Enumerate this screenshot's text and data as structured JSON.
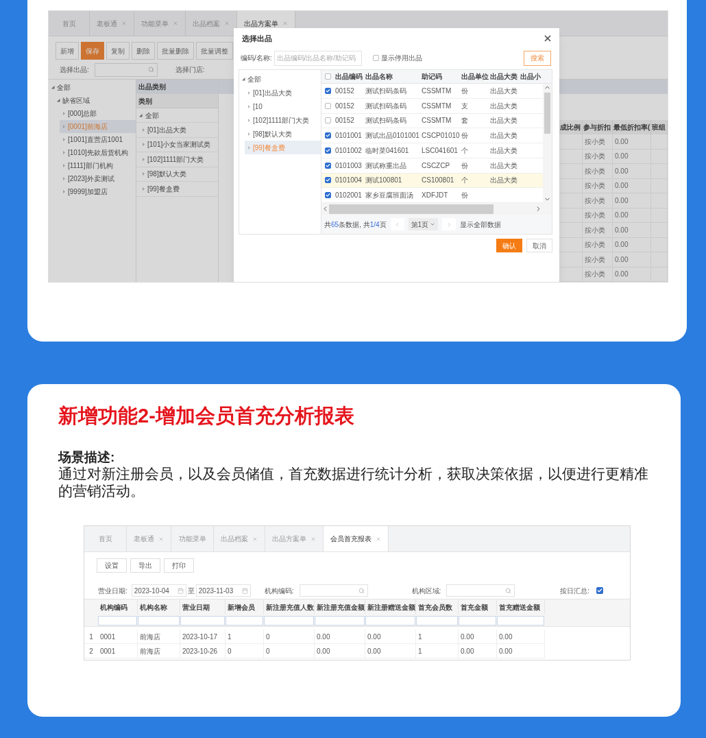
{
  "top_screenshot": {
    "tabs": [
      {
        "label": "首页",
        "closable": false,
        "selected": false
      },
      {
        "label": "老板通",
        "closable": true,
        "selected": false
      },
      {
        "label": "功能菜单",
        "closable": true,
        "selected": false
      },
      {
        "label": "出品档案",
        "closable": true,
        "selected": false
      },
      {
        "label": "出品方案单",
        "closable": true,
        "selected": true
      }
    ],
    "toolbar": [
      {
        "label": "新增",
        "primary": false
      },
      {
        "label": "保存",
        "primary": true
      },
      {
        "label": "复制",
        "primary": false
      },
      {
        "label": "删除",
        "primary": false
      },
      {
        "label": "批量删除",
        "primary": false
      },
      {
        "label": "批量调整",
        "primary": false
      }
    ],
    "product_label": "选择出品:",
    "store_label": "选择门店:",
    "org_tree": [
      {
        "label": "全部",
        "selected": false,
        "children": [
          {
            "label": "缺省区域",
            "selected": false,
            "children": [
              {
                "label": "[000]总部",
                "selected": false
              },
              {
                "label": "[0001]前海店",
                "selected": true
              },
              {
                "label": "[1001]直营店1001",
                "selected": false
              },
              {
                "label": "[1010]先款后货机构",
                "selected": false
              },
              {
                "label": "[1111]部门机构",
                "selected": false
              },
              {
                "label": "[2023]外卖测试",
                "selected": false
              },
              {
                "label": "[9999]加盟店",
                "selected": false
              }
            ]
          }
        ]
      }
    ],
    "category_panel": {
      "title": "出品类别",
      "column": "类别",
      "root": "全部",
      "items": [
        "[01]出品大类",
        "[101]小女当家测试类",
        "[102]1111部门大类",
        "[98]默认大类",
        "[99]餐盒费"
      ]
    },
    "grid": {
      "columns": [
        "成比例",
        "参与折扣",
        "最低折扣率(",
        "班组"
      ],
      "rows": [
        [
          "",
          "按小类",
          "0.00",
          ""
        ],
        [
          "",
          "按小类",
          "0.00",
          ""
        ],
        [
          "",
          "按小类",
          "0.00",
          ""
        ],
        [
          "",
          "按小类",
          "0.00",
          ""
        ],
        [
          "",
          "按小类",
          "0.00",
          ""
        ],
        [
          "",
          "按小类",
          "0.00",
          ""
        ],
        [
          "",
          "按小类",
          "0.00",
          ""
        ],
        [
          "",
          "按小类",
          "0.00",
          ""
        ],
        [
          "",
          "按小类",
          "0.00",
          ""
        ],
        [
          "",
          "按小类",
          "0.00",
          ""
        ]
      ]
    },
    "dialog": {
      "title": "选择出品",
      "search_label": "编码/名称:",
      "search_placeholder": "出品编码/出品名称/助记码",
      "show_disabled": {
        "label": "显示停用出品",
        "checked": false
      },
      "search_button": "搜索",
      "tree": [
        {
          "label": "全部",
          "selected": false,
          "children": [
            {
              "label": "[01]出品大类",
              "selected": false
            },
            {
              "label": "[10",
              "selected": false
            },
            {
              "label": "[102]1111部门大类",
              "selected": false
            },
            {
              "label": "[98]默认大类",
              "selected": false
            },
            {
              "label": "[99]餐盒费",
              "selected": true
            }
          ]
        }
      ],
      "select_all": false,
      "columns": [
        "出品编码",
        "出品名称",
        "助记码",
        "出品单位",
        "出品大类",
        "出品小"
      ],
      "rows": [
        {
          "checked": true,
          "selected": false,
          "cells": [
            "00152",
            "测试扫码条码",
            "CSSMTM",
            "份",
            "出品大类"
          ]
        },
        {
          "checked": false,
          "selected": false,
          "cells": [
            "00152",
            "测试扫码条码",
            "CSSMTM",
            "支",
            "出品大类"
          ]
        },
        {
          "checked": false,
          "selected": false,
          "cells": [
            "00152",
            "测试扫码条码",
            "CSSMTM",
            "套",
            "出品大类"
          ]
        },
        {
          "checked": true,
          "selected": false,
          "cells": [
            "0101001",
            "测试出品0101001",
            "CSCP01010",
            "份",
            "出品大类"
          ]
        },
        {
          "checked": true,
          "selected": false,
          "cells": [
            "0101002",
            "临时菜041601",
            "LSC041601",
            "个",
            "出品大类"
          ]
        },
        {
          "checked": true,
          "selected": false,
          "cells": [
            "0101003",
            "测试称重出品",
            "CSCZCP",
            "份",
            "出品大类"
          ]
        },
        {
          "checked": true,
          "selected": true,
          "cells": [
            "0101004",
            "测试100801",
            "CS100801",
            "个",
            "出品大类"
          ]
        },
        {
          "checked": true,
          "selected": false,
          "cells": [
            "0102001",
            "家乡豆腐班面汤",
            "XDFJDT",
            "份",
            ""
          ]
        }
      ],
      "pager": {
        "prefix": "共",
        "count": "65",
        "middle": "条数据, 共",
        "pages": "1/4",
        "suffix": "页",
        "page_select": "第1页",
        "show_all": "显示全部数据"
      },
      "confirm": "确认",
      "cancel": "取消"
    }
  },
  "feature": {
    "title": "新增功能2-增加会员首充分析报表",
    "scenario_label": "场景描述:",
    "description": "通过对新注册会员，以及会员储值，首充数据进行统计分析，获取决策依据，以便进行更精准的营销活动。",
    "report": {
      "tabs": [
        {
          "label": "首页",
          "closable": false,
          "selected": false
        },
        {
          "label": "老板通",
          "closable": true,
          "selected": false
        },
        {
          "label": "功能菜单",
          "closable": false,
          "selected": false
        },
        {
          "label": "出品档案",
          "closable": true,
          "selected": false
        },
        {
          "label": "出品方案单",
          "closable": true,
          "selected": false
        },
        {
          "label": "会员首充报表",
          "closable": true,
          "selected": true
        }
      ],
      "toolbar": [
        "设置",
        "导出",
        "打印"
      ],
      "date_label": "营业日期:",
      "date_from": "2023-10-04",
      "date_sep": "至",
      "date_to": "2023-11-03",
      "org_code_label": "机构编码:",
      "org_area_label": "机构区域:",
      "daily_label": "按日汇总:",
      "daily_checked": true,
      "columns": [
        "机构编码",
        "机构名称",
        "营业日期",
        "新增会员",
        "新注册充值人数",
        "新注册充值金额",
        "新注册赠送金额",
        "首充会员数",
        "首充金额",
        "首充赠送金额"
      ],
      "rows": [
        {
          "num": "1",
          "cells": [
            "0001",
            "前海店",
            "2023-10-17",
            "1",
            "0",
            "0.00",
            "0.00",
            "1",
            "0.00",
            "0.00"
          ]
        },
        {
          "num": "2",
          "cells": [
            "0001",
            "前海店",
            "2023-10-26",
            "0",
            "0",
            "0.00",
            "0.00",
            "1",
            "0.00",
            "0.00"
          ]
        }
      ]
    }
  }
}
